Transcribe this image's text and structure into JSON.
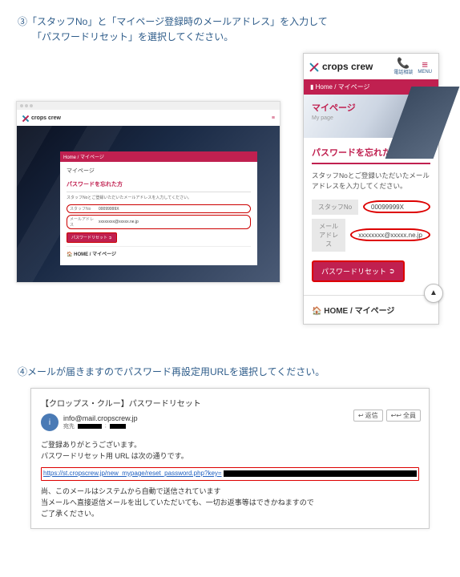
{
  "step3": {
    "text": "③「スタッフNo」と「マイページ登録時のメールアドレス」を入力して\n　　「パスワードリセット」を選択してください。"
  },
  "desktop": {
    "logo_text": "crops crew",
    "breadcrumb": "Home / マイページ",
    "page_title": "マイページ",
    "section_title": "パスワードを忘れた方",
    "desc": "スタッフNoとご登録いただいたメールアドレスを入力してください。",
    "staff_label": "スタッフNo",
    "staff_value": "00099999X",
    "mail_label": "メールアドレス",
    "mail_value": "xxxxxxxx@xxxxx.ne.jp",
    "reset_btn": "パスワードリセット",
    "home_link": "🏠 HOME / マイページ"
  },
  "mobile": {
    "logo_text": "crops crew",
    "tel_label": "電話相談",
    "menu_label": "MENU",
    "breadcrumb": "Home / マイページ",
    "hero_title": "マイページ",
    "hero_sub": "My page",
    "section_title": "パスワードを忘れた方",
    "desc": "スタッフNoとご登録いただいたメールアドレスを入力してください。",
    "staff_label": "スタッフNo",
    "staff_value": "00099999X",
    "mail_label": "メールアドレス",
    "mail_value": "xxxxxxxx@xxxxx.ne.jp",
    "reset_btn": "パスワードリセット",
    "home_link": "🏠 HOME / マイページ",
    "scroll_top": "▲"
  },
  "step4": {
    "text": "④メールが届きますのでパスワード再設定用URLを選択してください。"
  },
  "email": {
    "subject": "【クロップス・クルー】パスワードリセット",
    "avatar": "i",
    "from": "info@mail.cropscrew.jp",
    "meta_label": "宛先",
    "reply": "返信",
    "reply_all": "全員",
    "body1": "ご登録ありがとうございます。",
    "body2": "パスワードリセット用 URL は次の通りです。",
    "url": "https://st.cropscrew.jp/new_mypage/reset_password.php?key=",
    "body3": "尚、このメールはシステムから自動で送信されています",
    "body4": "当メールへ直接返信メールを出していただいても、一切お返事等はできかねますので",
    "body5": "ご了承ください。"
  }
}
